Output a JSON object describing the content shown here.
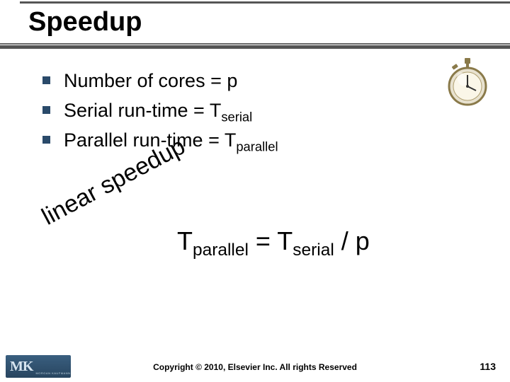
{
  "title": "Speedup",
  "bullets": [
    {
      "prefix": "Number of cores = p",
      "sub": ""
    },
    {
      "prefix": "Serial run-time = T",
      "sub": "serial"
    },
    {
      "prefix": "Parallel run-time = T",
      "sub": "parallel"
    }
  ],
  "diagonal_text": "linear speedup",
  "equation": {
    "lhs_base": "T",
    "lhs_sub": "parallel",
    "eq": " = ",
    "rhs_base": "T",
    "rhs_sub": "serial",
    "tail": "  / p"
  },
  "logo": {
    "m": "M",
    "k": "K",
    "small": "MORGAN KAUFMANN"
  },
  "copyright": "Copyright © 2010, Elsevier Inc. All rights Reserved",
  "page_number": "113",
  "icon_name": "stopwatch-icon"
}
